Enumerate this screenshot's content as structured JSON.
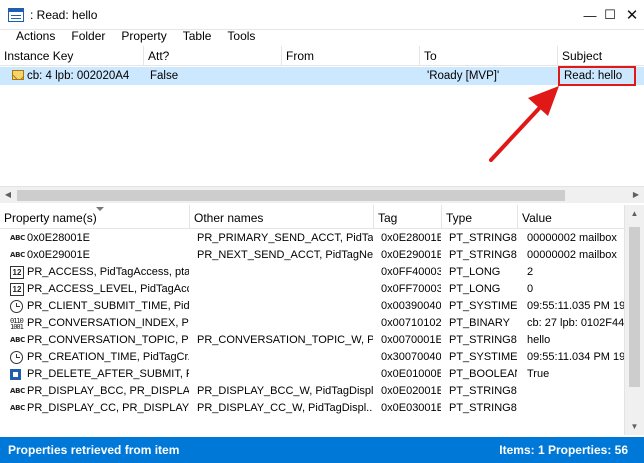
{
  "window": {
    "title": ": Read: hello",
    "minimize_glyph": "—",
    "maximize_glyph": "☐",
    "close_glyph": "✕"
  },
  "menu": [
    "Actions",
    "Folder",
    "Property",
    "Table",
    "Tools"
  ],
  "messages": {
    "columns": [
      "Instance Key",
      "Att?",
      "From",
      "To",
      "Subject"
    ],
    "rows": [
      {
        "instance_key": "cb: 4 lpb: 002020A4",
        "att": "False",
        "from": "",
        "to": "'Roady [MVP]'",
        "subject": "Read: hello",
        "icon": "envelope-icon"
      }
    ]
  },
  "properties": {
    "columns": [
      "Property name(s)",
      "Other names",
      "Tag",
      "Type",
      "Value"
    ],
    "rows": [
      {
        "icon": "string-icon",
        "name": "0x0E28001E",
        "other": "PR_PRIMARY_SEND_ACCT, PidTa...",
        "tag": "0x0E28001E",
        "type": "PT_STRING8",
        "value": "00000002    mailbox"
      },
      {
        "icon": "string-icon",
        "name": "0x0E29001E",
        "other": "PR_NEXT_SEND_ACCT, PidTagNe...",
        "tag": "0x0E29001E",
        "type": "PT_STRING8",
        "value": "00000002    mailbox"
      },
      {
        "icon": "number-icon",
        "name": "PR_ACCESS, PidTagAccess, pta...",
        "other": "",
        "tag": "0x0FF40003",
        "type": "PT_LONG",
        "value": "2"
      },
      {
        "icon": "number-icon",
        "name": "PR_ACCESS_LEVEL, PidTagAcce...",
        "other": "",
        "tag": "0x0FF70003",
        "type": "PT_LONG",
        "value": "0"
      },
      {
        "icon": "clock-icon",
        "name": "PR_CLIENT_SUBMIT_TIME, PidT...",
        "other": "",
        "tag": "0x00390040",
        "type": "PT_SYSTIME",
        "value": "09:55:11.035 PM 19-"
      },
      {
        "icon": "binary-icon",
        "name": "PR_CONVERSATION_INDEX, Pi...",
        "other": "",
        "tag": "0x00710102",
        "type": "PT_BINARY",
        "value": "cb: 27 lpb: 0102F447"
      },
      {
        "icon": "string-icon",
        "name": "PR_CONVERSATION_TOPIC, PR...",
        "other": "PR_CONVERSATION_TOPIC_W, Pi...",
        "tag": "0x0070001E",
        "type": "PT_STRING8",
        "value": "hello"
      },
      {
        "icon": "clock-icon",
        "name": "PR_CREATION_TIME, PidTagCr...",
        "other": "",
        "tag": "0x30070040",
        "type": "PT_SYSTIME",
        "value": "09:55:11.034 PM 19-"
      },
      {
        "icon": "boolean-icon",
        "name": "PR_DELETE_AFTER_SUBMIT, Pid...",
        "other": "",
        "tag": "0x0E01000B",
        "type": "PT_BOOLEAN",
        "value": "True"
      },
      {
        "icon": "string-icon",
        "name": "PR_DISPLAY_BCC, PR_DISPLAY_...",
        "other": "PR_DISPLAY_BCC_W, PidTagDispl...",
        "tag": "0x0E02001E",
        "type": "PT_STRING8",
        "value": ""
      },
      {
        "icon": "string-icon",
        "name": "PR_DISPLAY_CC, PR_DISPLAY_...",
        "other": "PR_DISPLAY_CC_W, PidTagDispl...",
        "tag": "0x0E03001E",
        "type": "PT_STRING8",
        "value": ""
      }
    ]
  },
  "icon_glyphs": {
    "string": "ABC",
    "number": "12",
    "binary": "0110 1001"
  },
  "scroll_glyphs": {
    "left": "◀",
    "right": "▶",
    "up": "▲",
    "down": "▼"
  },
  "status": {
    "left": "Properties retrieved from item",
    "right": "Items: 1   Properties: 56"
  },
  "colors": {
    "accent": "#0078d7",
    "selection": "#cce8ff",
    "highlight": "#e01818"
  }
}
